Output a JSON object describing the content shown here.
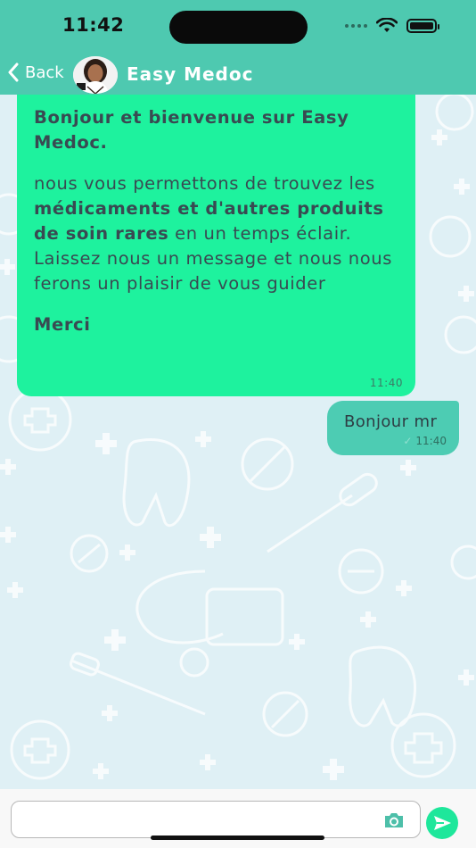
{
  "status_bar": {
    "time": "11:42"
  },
  "header": {
    "back_label": "Back",
    "title": "Easy Medoc"
  },
  "messages": {
    "incoming": {
      "greeting": "Bonjour et bienvenue sur Easy Medoc.",
      "body_part1": "nous vous permettons de trouvez les ",
      "body_bold": "médicaments et d'autres produits de soin rares",
      "body_part2": " en un temps éclair.",
      "body_part3": "Laissez nous un message et nous nous ferons un plaisir de vous guider",
      "thanks": "Merci",
      "time": "11:40"
    },
    "outgoing": {
      "text": "Bonjour mr",
      "time": "11:40"
    }
  },
  "composer": {
    "placeholder": ""
  },
  "colors": {
    "header": "#4ec9b0",
    "incoming_bubble": "#1ef29e",
    "outgoing_bubble": "#4dccb3",
    "background": "#dff0f5",
    "send_button": "#1ee79b"
  },
  "icons": [
    "wifi-icon",
    "battery-icon",
    "chevron-left-icon",
    "camera-icon",
    "send-icon"
  ]
}
